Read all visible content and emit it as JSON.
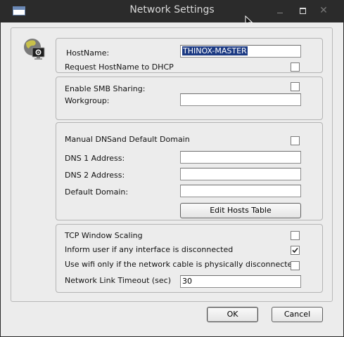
{
  "window": {
    "title": "Network Settings",
    "icons": {
      "app": "window-icon",
      "minimize": "minimize-icon",
      "maximize": "maximize-icon",
      "close": "close-icon",
      "settings": "network-settings-icon",
      "cursor": "mouse-pointer-icon"
    }
  },
  "hostname_group": {
    "hostname_label": "HostName:",
    "hostname_value": "THINOX-MASTER",
    "request_dhcp_label": "Request HostName to DHCP",
    "request_dhcp_checked": false
  },
  "smb_group": {
    "enable_smb_label": "Enable SMB Sharing:",
    "enable_smb_checked": false,
    "workgroup_label": "Workgroup:",
    "workgroup_value": ""
  },
  "dns_group": {
    "manual_dns_label": "Manual DNSand Default Domain",
    "manual_dns_checked": false,
    "dns1_label": "DNS 1 Address:",
    "dns1_value": "",
    "dns2_label": "DNS 2 Address:",
    "dns2_value": "",
    "domain_label": "Default Domain:",
    "domain_value": "",
    "edit_hosts_label": "Edit Hosts Table"
  },
  "tcp_group": {
    "tcp_scaling_label": "TCP Window Scaling",
    "tcp_scaling_checked": false,
    "inform_user_label": "Inform user if any interface is disconnected",
    "inform_user_checked": true,
    "wifi_only_label": "Use wifi only if the network cable is physically disconnected",
    "wifi_only_checked": false,
    "link_timeout_label": "Network Link Timeout (sec)",
    "link_timeout_value": "30"
  },
  "dialog_buttons": {
    "ok_label": "OK",
    "cancel_label": "Cancel"
  }
}
